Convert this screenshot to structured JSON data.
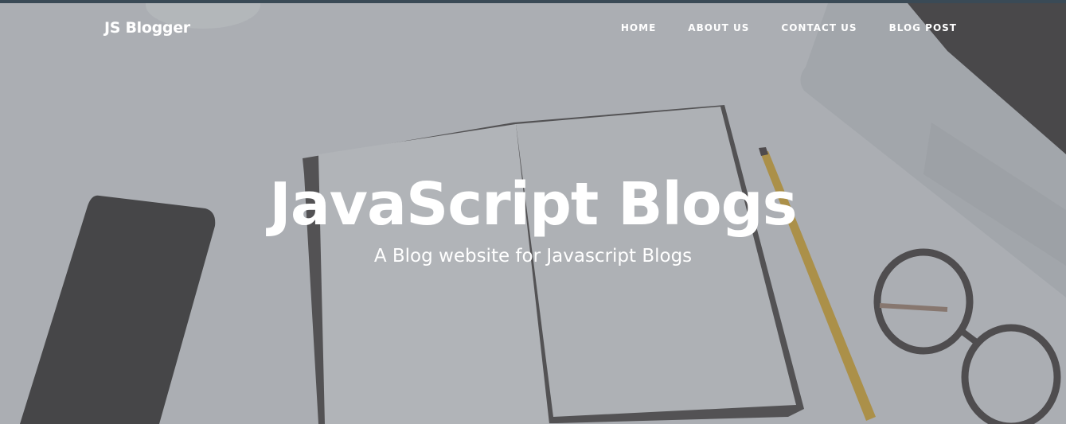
{
  "navbar": {
    "brand": "JS Blogger",
    "links": [
      {
        "label": "HOME"
      },
      {
        "label": "ABOUT US"
      },
      {
        "label": "CONTACT US"
      },
      {
        "label": "BLOG POST"
      }
    ]
  },
  "hero": {
    "title": "JavaScript Blogs",
    "subtitle": "A Blog website for Javascript Blogs",
    "background_image": "desk-with-notebook-phone-pencil-glasses-laptop",
    "overlay_color": "#6e7278"
  }
}
